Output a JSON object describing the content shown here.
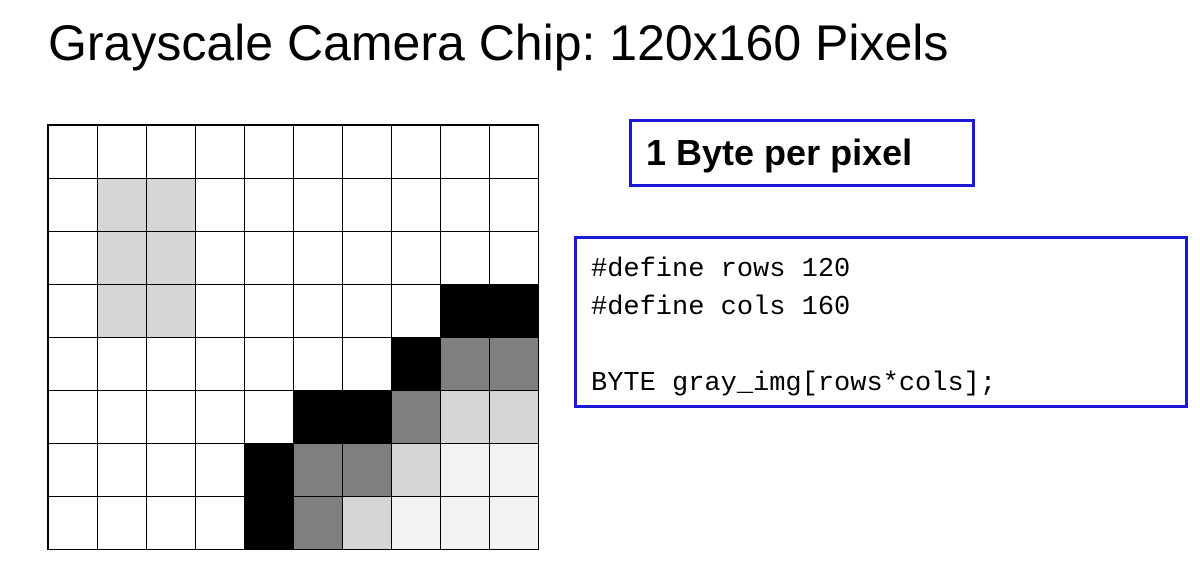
{
  "title": "Grayscale Camera Chip: 120x160 Pixels",
  "badge": "1 Byte per pixel",
  "code_lines": [
    "#define rows 120",
    "#define cols 160",
    "",
    "BYTE gray_img[rows*cols];"
  ],
  "colors": {
    "white": "#ffffff",
    "light": "#d6d6d6",
    "lighter": "#f2f2f2",
    "mid": "#7f7f7f",
    "black": "#000000",
    "border_blue": "#1a1ad6"
  },
  "pixel_grid": {
    "rows": 8,
    "cols": 10,
    "values": [
      [
        "white",
        "white",
        "white",
        "white",
        "white",
        "white",
        "white",
        "white",
        "white",
        "white"
      ],
      [
        "white",
        "light",
        "light",
        "white",
        "white",
        "white",
        "white",
        "white",
        "white",
        "white"
      ],
      [
        "white",
        "light",
        "light",
        "white",
        "white",
        "white",
        "white",
        "white",
        "white",
        "white"
      ],
      [
        "white",
        "light",
        "light",
        "white",
        "white",
        "white",
        "white",
        "white",
        "black",
        "black"
      ],
      [
        "white",
        "white",
        "white",
        "white",
        "white",
        "white",
        "white",
        "black",
        "mid",
        "mid"
      ],
      [
        "white",
        "white",
        "white",
        "white",
        "white",
        "black",
        "black",
        "mid",
        "light",
        "light"
      ],
      [
        "white",
        "white",
        "white",
        "white",
        "black",
        "mid",
        "mid",
        "light",
        "lighter",
        "lighter"
      ],
      [
        "white",
        "white",
        "white",
        "white",
        "black",
        "mid",
        "light",
        "lighter",
        "lighter",
        "lighter"
      ]
    ]
  }
}
